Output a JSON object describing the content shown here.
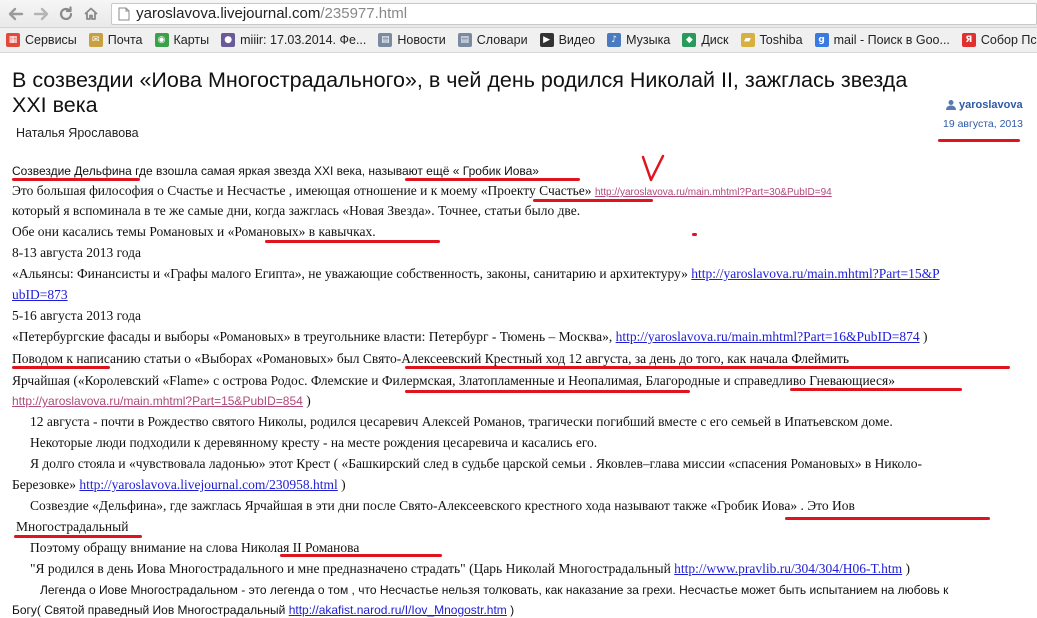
{
  "browser": {
    "url_host": "yaroslavova.livejournal.com",
    "url_path": "/235977.html",
    "bookmarks": [
      {
        "label": "Сервисы",
        "icon": "apps-grid-icon",
        "color": "#e04a3a"
      },
      {
        "label": "Почта",
        "icon": "mail-icon",
        "color": "#c8a040"
      },
      {
        "label": "Карты",
        "icon": "maps-icon",
        "color": "#3aa04a"
      },
      {
        "label": "miiir: 17.03.2014. Фе...",
        "icon": "user-icon",
        "color": "#6a5a9a"
      },
      {
        "label": "Новости",
        "icon": "page-icon",
        "color": "#7a8aa0"
      },
      {
        "label": "Словари",
        "icon": "page-icon",
        "color": "#7a8aa0"
      },
      {
        "label": "Видео",
        "icon": "video-icon",
        "color": "#333333"
      },
      {
        "label": "Музыка",
        "icon": "music-icon",
        "color": "#4a7ac0"
      },
      {
        "label": "Диск",
        "icon": "disk-icon",
        "color": "#2a9a5a"
      },
      {
        "label": "Toshiba",
        "icon": "folder-icon",
        "color": "#d8b040"
      },
      {
        "label": "mail - Поиск в Goo...",
        "icon": "google-icon",
        "color": "#3a7ae0"
      },
      {
        "label": "Собор Псков",
        "icon": "yandex-icon",
        "color": "#e03030"
      }
    ]
  },
  "post": {
    "title": "В созвездии «Иова Многострадального», в чей день родился Николай II, зажглась звезда XXI века",
    "author_name": "Наталья Ярославова",
    "username": "yaroslavova",
    "date": "19 августа, 2013"
  },
  "body": {
    "l1": "Созвездие Дельфина где взошла самая яркая звезда XXI века, называют ещё « Гробик Иова»",
    "l2a": "Это большая философия о Счастье и Несчастье , имеющая отношение и к моему «Проекту Счастье» ",
    "l2_link": "http://yaroslavova.ru/main.mhtml?Part=30&PubID=94",
    "l3": "который я вспоминала в те же самые дни, когда зажглась «Новая Звезда». Точнее, статьи было две.",
    "l4": "Обе они касались темы Романовых и «Романовых» в кавычках.",
    "l5": "8-13 августа 2013 года",
    "l6a": "«Альянсы: Финансисты и «Графы малого Египта», не уважающие собственность, законы, санитарию и архитектуру» ",
    "l6_link_part1": "http://yaroslavova.ru/main.mhtml?Part=15&P",
    "l7_link_part2": "ubID=873",
    "l8": "5-16 августа 2013 года",
    "l9a": "«Петербургские фасады и выборы «Романовых» в треугольнике власти: Петербург - Тюмень – Москва», ",
    "l9_link": "http://yaroslavova.ru/main.mhtml?Part=16&PubID=874",
    "l9b": " )",
    "l10": "Поводом к написанию статьи о «Выборах «Романовых» был Свято-Алексеевский Крестный ход 12 августа, за день до того, как начала Флеймить",
    "l11": "Ярчайшая («Королевский «Flame» с острова Родос. Флемские и Филермская, Златопламенные и Неопалимая, Благородные и справедливо Гневающиеся»",
    "l12_link": "http://yaroslavova.ru/main.mhtml?Part=15&PubID=854",
    "l12b": " )",
    "l13": "12 августа - почти в Рождество святого Николы, родился цесаревич Алексей Романов, трагически погибший вместе с его семьей в Ипатьевском доме.",
    "l14": "Некоторые люди подходили к деревянному кресту - на месте рождения цесаревича и касались его.",
    "l15": "Я долго стояла и «чувствовала ладонью» этот Крест ( «Башкирский след в судьбе царской семьи . Яковлев–глава миссии «спасения Романовых» в Николо-",
    "l16a": "Березовке» ",
    "l16_link": "http://yaroslavova.livejournal.com/230958.html",
    "l16b": " )",
    "l17": "Созвездие «Дельфина», где зажглась Ярчайшая в эти дни после Свято-Алексеевского крестного хода называют также «Гробик Иова» . Это Иов",
    "l18": "Многострадальный",
    "l19": "Поэтому обращу внимание на слова Николая II Романова",
    "l20a": "\"Я родился в день Иова Многострадального и мне предназначено страдать\" (Царь Николай Многострадальный ",
    "l20_link": "http://www.pravlib.ru/304/304/H06-T.htm",
    "l20b": " )",
    "l21": "Легенда о Иове Многострадальном - это легенда о том , что Несчастье нельзя толковать, как наказание за грехи. Несчастье может быть испытанием на любовь к",
    "l22a": "Богу( Святой праведный Иов Многострадальный ",
    "l22_link": "http://akafist.narod.ru/I/Iov_Mnogostr.htm",
    "l22b": " )"
  },
  "colors": {
    "annotation": "#e0141e",
    "link": "#1d1dd6",
    "small_link": "#b04a7a",
    "lj_blue": "#2e5aa6"
  }
}
